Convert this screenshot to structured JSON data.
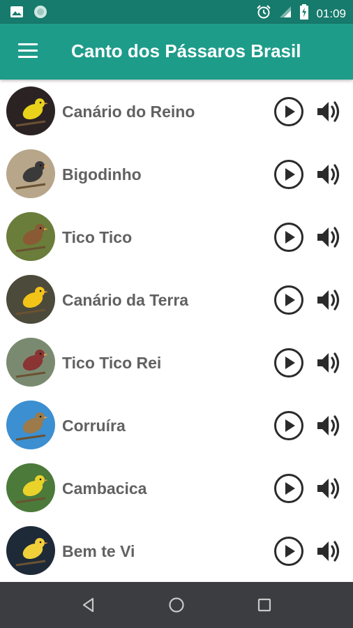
{
  "status_bar": {
    "time": "01:09",
    "left_icons": [
      "image-icon",
      "circle-notification-icon"
    ],
    "right_icons": [
      "alarm-icon",
      "signal-icon",
      "battery-charging-icon"
    ]
  },
  "app_bar": {
    "title": "Canto dos Pássaros Brasil",
    "menu_icon": "menu-icon",
    "color": "#1e9c8a",
    "status_color": "#167a6c"
  },
  "birds": [
    {
      "name": "Canário do Reino",
      "bg": "#2b2224",
      "bird": "#e8d21c"
    },
    {
      "name": "Bigodinho",
      "bg": "#b8a68a",
      "bird": "#3a3a3a"
    },
    {
      "name": "Tico Tico",
      "bg": "#6b7d3a",
      "bird": "#8a5a34"
    },
    {
      "name": "Canário da Terra",
      "bg": "#4c4a3a",
      "bird": "#f2c418"
    },
    {
      "name": "Tico Tico Rei",
      "bg": "#7a8a70",
      "bird": "#8a3434"
    },
    {
      "name": "Corruíra",
      "bg": "#3c8fd0",
      "bird": "#9c7a4a"
    },
    {
      "name": "Cambacica",
      "bg": "#4b7a3a",
      "bird": "#e9d22a"
    },
    {
      "name": "Bem te Vi",
      "bg": "#1e2a38",
      "bird": "#f0d03a"
    }
  ],
  "row_actions": {
    "play_icon": "play-circle-icon",
    "volume_icon": "volume-icon",
    "icon_color": "#2b2b2b"
  },
  "nav_bar": {
    "icons": [
      "back-icon",
      "home-icon",
      "recents-icon"
    ],
    "color": "#3b3d40"
  }
}
